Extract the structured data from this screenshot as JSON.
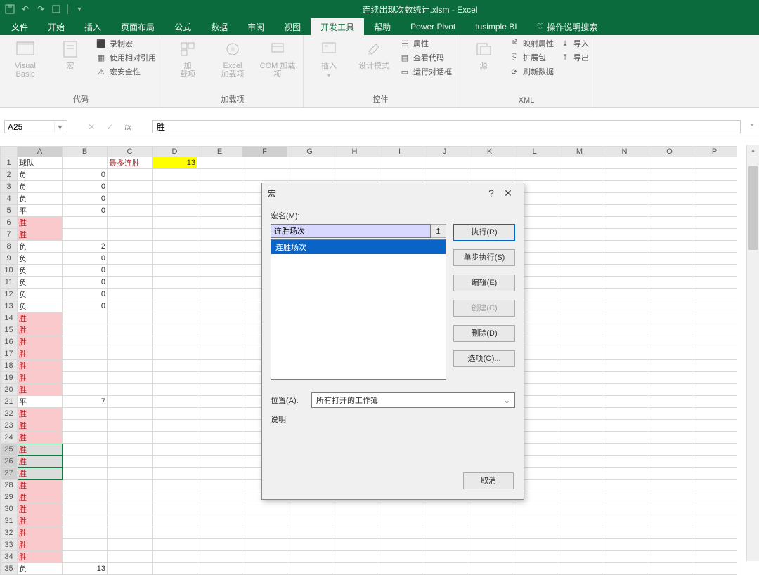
{
  "app": {
    "title": "连续出现次数统计.xlsm  -  Excel"
  },
  "tabs": {
    "file": "文件",
    "home": "开始",
    "insert": "插入",
    "layout": "页面布局",
    "formulas": "公式",
    "data": "数据",
    "review": "审阅",
    "view": "视图",
    "developer": "开发工具",
    "help": "帮助",
    "powerpivot": "Power Pivot",
    "tusimple": "tusimple BI",
    "tellme": "操作说明搜索"
  },
  "ribbon": {
    "code": {
      "vb": "Visual Basic",
      "macros": "宏",
      "record": "录制宏",
      "relative": "使用相对引用",
      "security": "宏安全性",
      "label": "代码"
    },
    "addins": {
      "addins": "加\n载项",
      "excel": "Excel\n加载项",
      "com": "COM 加载项",
      "label": "加载项"
    },
    "controls": {
      "insert": "插入",
      "design": "设计模式",
      "props": "属性",
      "viewcode": "查看代码",
      "rundialog": "运行对话框",
      "label": "控件"
    },
    "xml": {
      "source": "源",
      "mapprops": "映射属性",
      "expansion": "扩展包",
      "refresh": "刷新数据",
      "import": "导入",
      "export": "导出",
      "label": "XML"
    }
  },
  "namebox": "A25",
  "formula": "胜",
  "columns": [
    "A",
    "B",
    "C",
    "D",
    "E",
    "F",
    "G",
    "H",
    "I",
    "J",
    "K",
    "L",
    "M",
    "N",
    "O",
    "P"
  ],
  "rows": [
    {
      "n": 1,
      "A": "球队",
      "C": "最多连胜",
      "D": "13",
      "cls": {
        "C": "cell-redtext",
        "D": "cell-yellow cell-right"
      }
    },
    {
      "n": 2,
      "A": "负",
      "B": "0",
      "cls": {
        "B": "cell-right"
      }
    },
    {
      "n": 3,
      "A": "负",
      "B": "0",
      "cls": {
        "B": "cell-right"
      }
    },
    {
      "n": 4,
      "A": "负",
      "B": "0",
      "cls": {
        "B": "cell-right"
      }
    },
    {
      "n": 5,
      "A": "平",
      "B": "0",
      "cls": {
        "B": "cell-right"
      }
    },
    {
      "n": 6,
      "A": "胜",
      "cls": {
        "A": "cell-pink"
      }
    },
    {
      "n": 7,
      "A": "胜",
      "cls": {
        "A": "cell-pink"
      }
    },
    {
      "n": 8,
      "A": "负",
      "B": "2",
      "cls": {
        "B": "cell-right"
      }
    },
    {
      "n": 9,
      "A": "负",
      "B": "0",
      "cls": {
        "B": "cell-right"
      }
    },
    {
      "n": 10,
      "A": "负",
      "B": "0",
      "cls": {
        "B": "cell-right"
      }
    },
    {
      "n": 11,
      "A": "负",
      "B": "0",
      "cls": {
        "B": "cell-right"
      }
    },
    {
      "n": 12,
      "A": "负",
      "B": "0",
      "cls": {
        "B": "cell-right"
      }
    },
    {
      "n": 13,
      "A": "负",
      "B": "0",
      "cls": {
        "B": "cell-right"
      }
    },
    {
      "n": 14,
      "A": "胜",
      "cls": {
        "A": "cell-pink"
      }
    },
    {
      "n": 15,
      "A": "胜",
      "cls": {
        "A": "cell-pink"
      }
    },
    {
      "n": 16,
      "A": "胜",
      "cls": {
        "A": "cell-pink"
      }
    },
    {
      "n": 17,
      "A": "胜",
      "cls": {
        "A": "cell-pink"
      }
    },
    {
      "n": 18,
      "A": "胜",
      "cls": {
        "A": "cell-pink"
      }
    },
    {
      "n": 19,
      "A": "胜",
      "cls": {
        "A": "cell-pink"
      }
    },
    {
      "n": 20,
      "A": "胜",
      "cls": {
        "A": "cell-pink"
      }
    },
    {
      "n": 21,
      "A": "平",
      "B": "7",
      "cls": {
        "B": "cell-right"
      }
    },
    {
      "n": 22,
      "A": "胜",
      "cls": {
        "A": "cell-pink"
      }
    },
    {
      "n": 23,
      "A": "胜",
      "cls": {
        "A": "cell-pink"
      }
    },
    {
      "n": 24,
      "A": "胜",
      "cls": {
        "A": "cell-pink"
      }
    },
    {
      "n": 25,
      "A": "胜",
      "cls": {
        "A": "cell-pink",
        "row": "sel"
      }
    },
    {
      "n": 26,
      "A": "胜",
      "cls": {
        "A": "cell-pink",
        "row": "sel2"
      }
    },
    {
      "n": 27,
      "A": "胜",
      "cls": {
        "A": "cell-pink",
        "row": "sel3"
      }
    },
    {
      "n": 28,
      "A": "胜",
      "cls": {
        "A": "cell-pink"
      }
    },
    {
      "n": 29,
      "A": "胜",
      "cls": {
        "A": "cell-pink"
      }
    },
    {
      "n": 30,
      "A": "胜",
      "cls": {
        "A": "cell-pink"
      }
    },
    {
      "n": 31,
      "A": "胜",
      "cls": {
        "A": "cell-pink"
      }
    },
    {
      "n": 32,
      "A": "胜",
      "cls": {
        "A": "cell-pink"
      }
    },
    {
      "n": 33,
      "A": "胜",
      "cls": {
        "A": "cell-pink"
      }
    },
    {
      "n": 34,
      "A": "胜",
      "cls": {
        "A": "cell-pink"
      }
    },
    {
      "n": 35,
      "A": "负",
      "B": "13",
      "cls": {
        "B": "cell-right"
      }
    }
  ],
  "dialog": {
    "title": "宏",
    "name_label": "宏名(M):",
    "name_value": "连胜场次",
    "list": [
      "连胜场次"
    ],
    "run": "执行(R)",
    "step": "单步执行(S)",
    "edit": "编辑(E)",
    "create": "创建(C)",
    "delete": "删除(D)",
    "options": "选项(O)...",
    "loc_label": "位置(A):",
    "loc_value": "所有打开的工作簿",
    "desc_label": "说明",
    "cancel": "取消"
  }
}
